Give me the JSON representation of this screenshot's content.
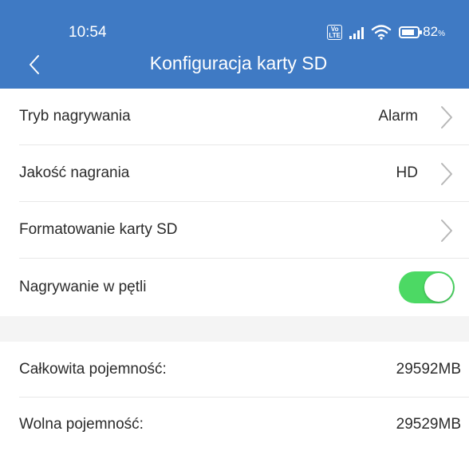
{
  "status_bar": {
    "time": "10:54",
    "volte": "Vo LTE",
    "battery_percent": "82",
    "battery_unit": "%",
    "battery_level": 0.82
  },
  "header": {
    "title": "Konfiguracja karty SD",
    "back_icon": "chevron-left-icon",
    "background": "#3f7ac4"
  },
  "settings": {
    "recording_mode": {
      "label": "Tryb nagrywania",
      "value": "Alarm"
    },
    "recording_quality": {
      "label": "Jakość nagrania",
      "value": "HD"
    },
    "format_sd": {
      "label": "Formatowanie karty SD"
    },
    "loop_recording": {
      "label": "Nagrywanie w pętli",
      "enabled": true,
      "toggle_color": "#4cd964"
    }
  },
  "storage": {
    "total": {
      "label": "Całkowita pojemność:",
      "value": "29592MB"
    },
    "free": {
      "label": "Wolna pojemność:",
      "value": "29529MB"
    }
  }
}
